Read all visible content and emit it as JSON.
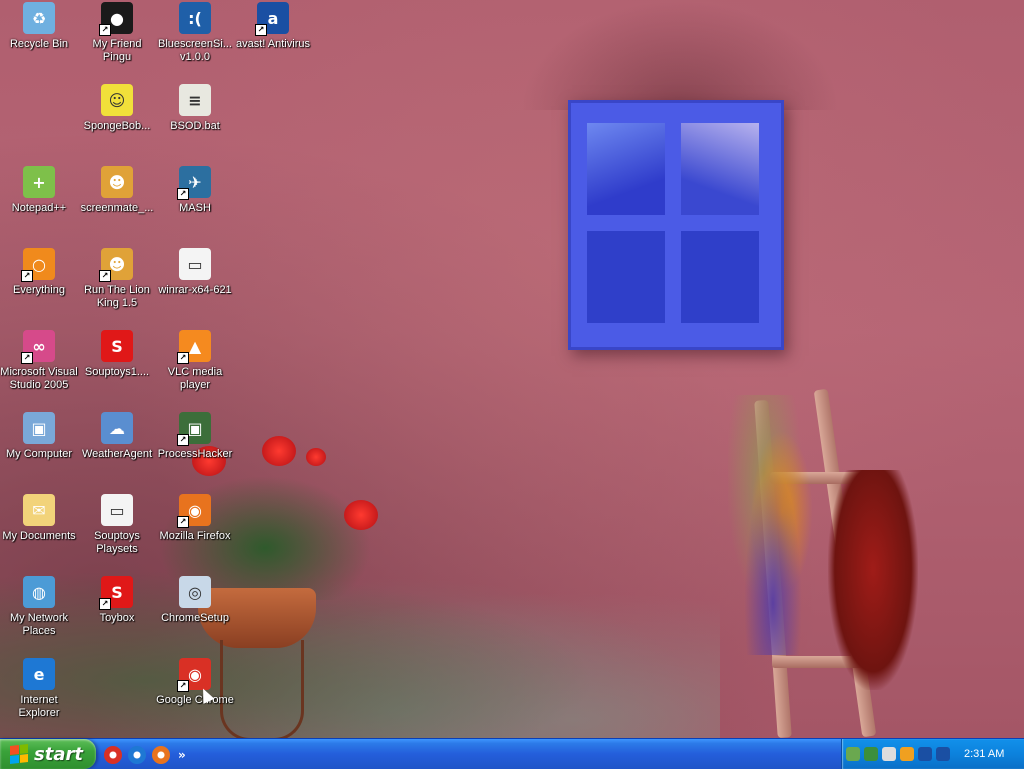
{
  "desktop": {
    "icons": [
      {
        "label": "Recycle Bin",
        "icon": "recycle-bin-icon",
        "color": "#6fb0e0",
        "glyph": "♻",
        "shortcut": false
      },
      {
        "label": "My Friend Pingu",
        "icon": "pingu-icon",
        "color": "#1a1a1a",
        "glyph": "●",
        "shortcut": true
      },
      {
        "label": "BluescreenSi... v1.0.0",
        "icon": "bluescreen-icon",
        "color": "#1f5fa8",
        "glyph": ":(",
        "shortcut": false
      },
      {
        "label": "avast! Antivirus",
        "icon": "avast-icon",
        "color": "#1a4fa3",
        "glyph": "a",
        "shortcut": true
      },
      {
        "label": "SpongeBob...",
        "icon": "spongebob-icon",
        "color": "#f1e03a",
        "glyph": "☺",
        "shortcut": false
      },
      {
        "label": "BSOD.bat",
        "icon": "batch-file-icon",
        "color": "#e8e8e0",
        "glyph": "≡",
        "shortcut": false
      },
      {
        "label": "Notepad++",
        "icon": "notepadpp-icon",
        "color": "#7ec04a",
        "glyph": "+",
        "shortcut": false
      },
      {
        "label": "screenmate_...",
        "icon": "screenmate-icon",
        "color": "#e0a238",
        "glyph": "☻",
        "shortcut": false
      },
      {
        "label": "MASH",
        "icon": "mash-icon",
        "color": "#2c6fa0",
        "glyph": "✈",
        "shortcut": true
      },
      {
        "label": "Everything",
        "icon": "everything-icon",
        "color": "#f08a1c",
        "glyph": "○",
        "shortcut": true
      },
      {
        "label": "Run The Lion King 1.5",
        "icon": "lion-king-icon",
        "color": "#e0a238",
        "glyph": "☻",
        "shortcut": true
      },
      {
        "label": "winrar-x64-621",
        "icon": "installer-window-icon",
        "color": "#f4f4f4",
        "glyph": "▭",
        "shortcut": false
      },
      {
        "label": "Microsoft Visual Studio 2005",
        "icon": "visual-studio-icon",
        "color": "#d64a8a",
        "glyph": "∞",
        "shortcut": true
      },
      {
        "label": "Souptoys1....",
        "icon": "souptoys-icon",
        "color": "#e01818",
        "glyph": "S",
        "shortcut": false
      },
      {
        "label": "VLC media player",
        "icon": "vlc-icon",
        "color": "#f58a1f",
        "glyph": "▲",
        "shortcut": true
      },
      {
        "label": "My Computer",
        "icon": "my-computer-icon",
        "color": "#7aa8d8",
        "glyph": "▣",
        "shortcut": false
      },
      {
        "label": "WeatherAgent",
        "icon": "weatheragent-icon",
        "color": "#5a8ed0",
        "glyph": "☁",
        "shortcut": false
      },
      {
        "label": "ProcessHacker",
        "icon": "processhacker-icon",
        "color": "#3c6e3a",
        "glyph": "▣",
        "shortcut": true
      },
      {
        "label": "My Documents",
        "icon": "my-documents-icon",
        "color": "#f2d37a",
        "glyph": "✉",
        "shortcut": false
      },
      {
        "label": "Souptoys Playsets",
        "icon": "installer-window-icon",
        "color": "#f4f4f4",
        "glyph": "▭",
        "shortcut": false
      },
      {
        "label": "Mozilla Firefox",
        "icon": "firefox-icon",
        "color": "#e8731e",
        "glyph": "◉",
        "shortcut": true
      },
      {
        "label": "My Network Places",
        "icon": "network-places-icon",
        "color": "#4c9bd6",
        "glyph": "◍",
        "shortcut": false
      },
      {
        "label": "Toybox",
        "icon": "toybox-icon",
        "color": "#e01818",
        "glyph": "S",
        "shortcut": true
      },
      {
        "label": "ChromeSetup",
        "icon": "chromesetup-icon",
        "color": "#c8d8e8",
        "glyph": "◎",
        "shortcut": false
      },
      {
        "label": "Internet Explorer",
        "icon": "internet-explorer-icon",
        "color": "#1e78d4",
        "glyph": "e",
        "shortcut": false
      },
      {
        "label": "Google Chrome",
        "icon": "chrome-icon",
        "color": "#d93025",
        "glyph": "◉",
        "shortcut": true
      }
    ]
  },
  "taskbar": {
    "start_label": "start",
    "quick_launch": [
      {
        "icon": "chrome-icon",
        "color": "#d93025"
      },
      {
        "icon": "internet-explorer-icon",
        "color": "#1e78d4"
      },
      {
        "icon": "firefox-icon",
        "color": "#e8731e"
      }
    ],
    "more_label": "»",
    "tray_icons": [
      {
        "icon": "network-tray-icon",
        "color": "#6aa84f"
      },
      {
        "icon": "recycle-tray-icon",
        "color": "#3c8f3c"
      },
      {
        "icon": "printer-tray-icon",
        "color": "#dddddd"
      },
      {
        "icon": "search-tray-icon",
        "color": "#f0a020"
      },
      {
        "icon": "info-tray-icon",
        "color": "#1a4fa3"
      },
      {
        "icon": "avast-tray-icon",
        "color": "#1a4fa3"
      }
    ],
    "clock": "2:31 AM"
  }
}
